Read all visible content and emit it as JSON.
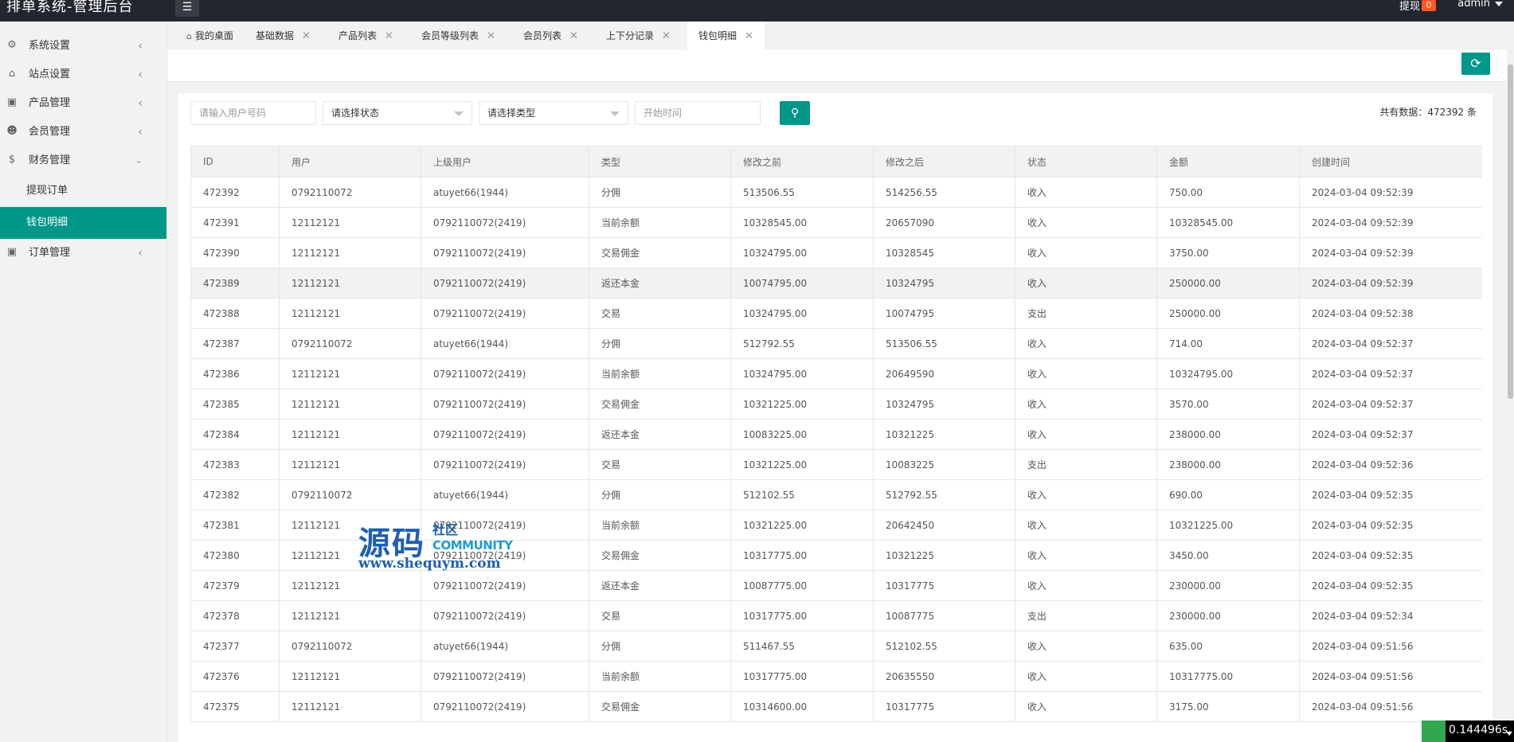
{
  "app": {
    "title": "排单系统-管理后台",
    "menu_toggle_icon": "hamburger-icon",
    "withdraw_label": "提现",
    "withdraw_badge": "0",
    "user": "admin"
  },
  "sidebar": {
    "items": [
      {
        "label": "系统设置",
        "icon": "gear-icon"
      },
      {
        "label": "站点设置",
        "icon": "home-icon"
      },
      {
        "label": "产品管理",
        "icon": "box-icon"
      },
      {
        "label": "会员管理",
        "icon": "user-icon"
      },
      {
        "label": "财务管理",
        "icon": "dollar-icon"
      },
      {
        "label": "订单管理",
        "icon": "box-icon"
      }
    ],
    "finance_sub": [
      {
        "label": "提现订单"
      },
      {
        "label": "钱包明细"
      }
    ]
  },
  "tabs": [
    {
      "label": "我的桌面"
    },
    {
      "label": "基础数据"
    },
    {
      "label": "产品列表"
    },
    {
      "label": "会员等级列表"
    },
    {
      "label": "会员列表"
    },
    {
      "label": "上下分记录"
    },
    {
      "label": "钱包明细"
    }
  ],
  "filters": {
    "user_placeholder": "请输入用户号码",
    "status_select": "请选择状态",
    "type_select": "请选择类型",
    "start_time_placeholder": "开始时间"
  },
  "total_text": "共有数据：472392 条",
  "table": {
    "headers": [
      "ID",
      "用户",
      "上级用户",
      "类型",
      "修改之前",
      "修改之后",
      "状态",
      "金额",
      "创建时间"
    ],
    "rows": [
      [
        "472392",
        "0792110072",
        "atuyet66(1944)",
        "分佣",
        "513506.55",
        "514256.55",
        "收入",
        "750.00",
        "2024-03-04 09:52:39"
      ],
      [
        "472391",
        "12112121",
        "0792110072(2419)",
        "当前余额",
        "10328545.00",
        "20657090",
        "收入",
        "10328545.00",
        "2024-03-04 09:52:39"
      ],
      [
        "472390",
        "12112121",
        "0792110072(2419)",
        "交易佣金",
        "10324795.00",
        "10328545",
        "收入",
        "3750.00",
        "2024-03-04 09:52:39"
      ],
      [
        "472389",
        "12112121",
        "0792110072(2419)",
        "返还本金",
        "10074795.00",
        "10324795",
        "收入",
        "250000.00",
        "2024-03-04 09:52:39"
      ],
      [
        "472388",
        "12112121",
        "0792110072(2419)",
        "交易",
        "10324795.00",
        "10074795",
        "支出",
        "250000.00",
        "2024-03-04 09:52:38"
      ],
      [
        "472387",
        "0792110072",
        "atuyet66(1944)",
        "分佣",
        "512792.55",
        "513506.55",
        "收入",
        "714.00",
        "2024-03-04 09:52:37"
      ],
      [
        "472386",
        "12112121",
        "0792110072(2419)",
        "当前余额",
        "10324795.00",
        "20649590",
        "收入",
        "10324795.00",
        "2024-03-04 09:52:37"
      ],
      [
        "472385",
        "12112121",
        "0792110072(2419)",
        "交易佣金",
        "10321225.00",
        "10324795",
        "收入",
        "3570.00",
        "2024-03-04 09:52:37"
      ],
      [
        "472384",
        "12112121",
        "0792110072(2419)",
        "返还本金",
        "10083225.00",
        "10321225",
        "收入",
        "238000.00",
        "2024-03-04 09:52:37"
      ],
      [
        "472383",
        "12112121",
        "0792110072(2419)",
        "交易",
        "10321225.00",
        "10083225",
        "支出",
        "238000.00",
        "2024-03-04 09:52:36"
      ],
      [
        "472382",
        "0792110072",
        "atuyet66(1944)",
        "分佣",
        "512102.55",
        "512792.55",
        "收入",
        "690.00",
        "2024-03-04 09:52:35"
      ],
      [
        "472381",
        "12112121",
        "0792110072(2419)",
        "当前余额",
        "10321225.00",
        "20642450",
        "收入",
        "10321225.00",
        "2024-03-04 09:52:35"
      ],
      [
        "472380",
        "12112121",
        "0792110072(2419)",
        "交易佣金",
        "10317775.00",
        "10321225",
        "收入",
        "3450.00",
        "2024-03-04 09:52:35"
      ],
      [
        "472379",
        "12112121",
        "0792110072(2419)",
        "返还本金",
        "10087775.00",
        "10317775",
        "收入",
        "230000.00",
        "2024-03-04 09:52:35"
      ],
      [
        "472378",
        "12112121",
        "0792110072(2419)",
        "交易",
        "10317775.00",
        "10087775",
        "支出",
        "230000.00",
        "2024-03-04 09:52:34"
      ],
      [
        "472377",
        "0792110072",
        "atuyet66(1944)",
        "分佣",
        "511467.55",
        "512102.55",
        "收入",
        "635.00",
        "2024-03-04 09:51:56"
      ],
      [
        "472376",
        "12112121",
        "0792110072(2419)",
        "当前余额",
        "10317775.00",
        "20635550",
        "收入",
        "10317775.00",
        "2024-03-04 09:51:56"
      ],
      [
        "472375",
        "12112121",
        "0792110072(2419)",
        "交易佣金",
        "10314600.00",
        "10317775",
        "收入",
        "3175.00",
        "2024-03-04 09:51:56"
      ]
    ]
  },
  "watermark": {
    "big": "源码",
    "small": "社区",
    "community": "COMMUNITY",
    "url": "www.shequym.com"
  },
  "timer": "0.144496s",
  "colors": {
    "accent": "#009688",
    "topbar": "#23262e",
    "badge": "#ff5722"
  }
}
